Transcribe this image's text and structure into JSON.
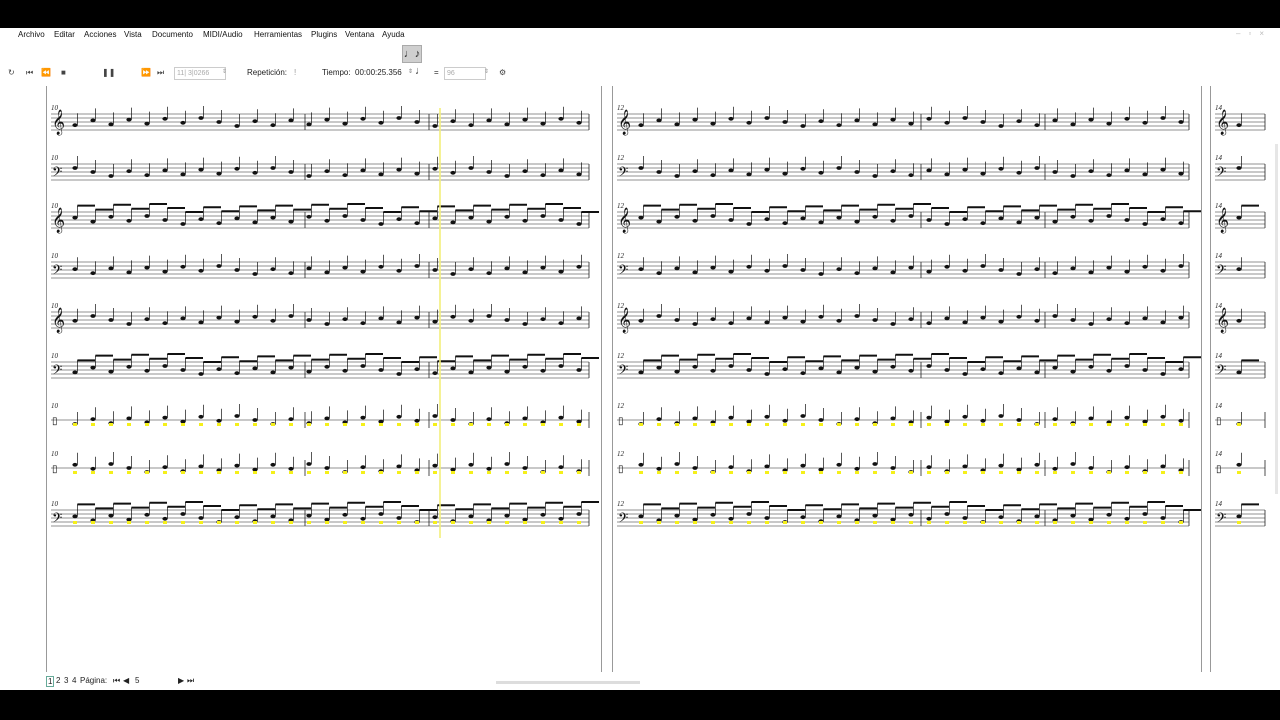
{
  "menu": {
    "items": [
      "Archivo",
      "Editar",
      "Acciones",
      "Vista",
      "Documento",
      "MIDI/Audio",
      "Herramientas",
      "Plugins",
      "Ventana",
      "Ayuda"
    ]
  },
  "toolbar": {
    "note_input_icon": "note-input-icon",
    "glyph": "♩♪"
  },
  "playback": {
    "measure_field": "11| 3|0266",
    "repeat_label": "Repetición:",
    "repeat_value": "!",
    "time_label": "Tiempo:",
    "time_value": "00:00:25.356",
    "tempo_eq": "=",
    "tempo_value": "96"
  },
  "score": {
    "pages": [
      {
        "measure_start": "10"
      },
      {
        "measure_start": "12"
      },
      {
        "measure_start": "14"
      }
    ]
  },
  "pagebar": {
    "page_numbers": [
      "1",
      "2",
      "3",
      "4"
    ],
    "label": "Página:",
    "current": "5"
  }
}
